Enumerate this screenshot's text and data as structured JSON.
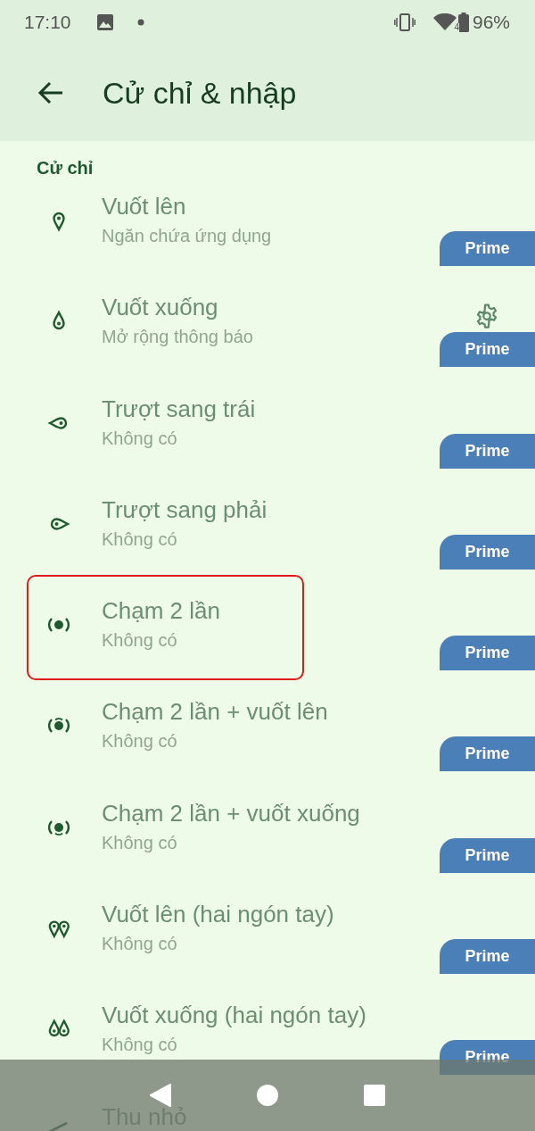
{
  "status_bar": {
    "time": "17:10",
    "wifi_label": "4",
    "battery": "96%"
  },
  "app_bar": {
    "title": "Cử chỉ & nhập"
  },
  "section": {
    "title": "Cử chỉ"
  },
  "gestures": [
    {
      "kind": "swipe_up",
      "title": "Vuốt lên",
      "subtitle": "Ngăn chứa ứng dụng",
      "badge": "Prime",
      "settings_button": false,
      "highlighted": false
    },
    {
      "kind": "swipe_down",
      "title": "Vuốt xuống",
      "subtitle": "Mở rộng thông báo",
      "badge": "Prime",
      "settings_button": true,
      "highlighted": false
    },
    {
      "kind": "swipe_left",
      "title": "Trượt sang trái",
      "subtitle": "Không có",
      "badge": "Prime",
      "settings_button": false,
      "highlighted": false
    },
    {
      "kind": "swipe_right",
      "title": "Trượt sang phải",
      "subtitle": "Không có",
      "badge": "Prime",
      "settings_button": false,
      "highlighted": false
    },
    {
      "kind": "double_tap",
      "title": "Chạm 2 lần",
      "subtitle": "Không có",
      "badge": "Prime",
      "settings_button": false,
      "highlighted": true
    },
    {
      "kind": "double_tap_up",
      "title": "Chạm 2 lần + vuốt lên",
      "subtitle": "Không có",
      "badge": "Prime",
      "settings_button": false,
      "highlighted": false
    },
    {
      "kind": "double_tap_down",
      "title": "Chạm 2 lần + vuốt xuống",
      "subtitle": "Không có",
      "badge": "Prime",
      "settings_button": false,
      "highlighted": false
    },
    {
      "kind": "two_finger_up",
      "title": "Vuốt lên (hai ngón tay)",
      "subtitle": "Không có",
      "badge": "Prime",
      "settings_button": false,
      "highlighted": false
    },
    {
      "kind": "two_finger_down",
      "title": "Vuốt xuống (hai ngón tay)",
      "subtitle": "Không có",
      "badge": "Prime",
      "settings_button": false,
      "highlighted": false
    },
    {
      "kind": "pinch",
      "title": "Thu nhỏ",
      "settings_button": false,
      "highlighted": false
    }
  ]
}
